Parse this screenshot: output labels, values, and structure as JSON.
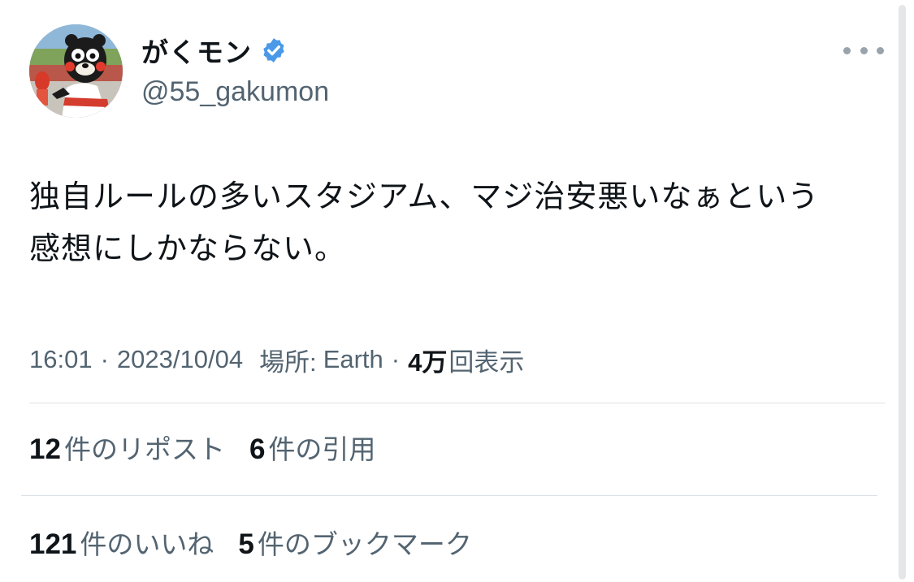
{
  "author": {
    "display_name": "がくモン",
    "handle": "@55_gakumon",
    "verified": true,
    "verified_color": "#4a99e9"
  },
  "icons": {
    "more": "more-horizontal-icon",
    "verified": "verified-badge-icon"
  },
  "tweet": {
    "text": "独自ルールの多いスタジアム、マジ治安悪いなぁという\n感想にしかならない。"
  },
  "meta": {
    "time": "16:01",
    "date": "2023/10/04",
    "separator": "·",
    "place_label": "場所:",
    "place_value": "Earth",
    "views_count": "4万",
    "views_label": "回表示"
  },
  "stats": {
    "row1": [
      {
        "count": "12",
        "label": "件のリポスト"
      },
      {
        "count": "6",
        "label": "件の引用"
      }
    ],
    "row2": [
      {
        "count": "121",
        "label": "件のいいね"
      },
      {
        "count": "5",
        "label": "件のブックマーク"
      }
    ]
  },
  "colors": {
    "text_primary": "#0f1419",
    "text_secondary": "#536471",
    "divider": "#dbe1e5"
  }
}
